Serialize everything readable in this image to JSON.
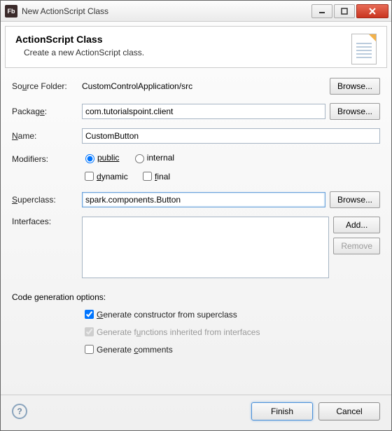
{
  "window": {
    "title": "New ActionScript Class"
  },
  "header": {
    "title": "ActionScript Class",
    "subtitle": "Create a new ActionScript class."
  },
  "form": {
    "sourceFolder": {
      "label": "Source Folder:",
      "value": "CustomControlApplication/src",
      "browse": "Browse..."
    },
    "package": {
      "label": "Package:",
      "value": "com.tutorialspoint.client",
      "browse": "Browse..."
    },
    "name": {
      "label": "Name:",
      "value": "CustomButton"
    },
    "modifiers": {
      "label": "Modifiers:",
      "public": "public",
      "internal": "internal",
      "dynamic": "dynamic",
      "final": "final",
      "selected": "public",
      "dynamicChecked": false,
      "finalChecked": false
    },
    "superclass": {
      "label": "Superclass:",
      "value": "spark.components.Button",
      "browse": "Browse..."
    },
    "interfaces": {
      "label": "Interfaces:",
      "add": "Add...",
      "remove": "Remove"
    }
  },
  "codeGen": {
    "title": "Code generation options:",
    "opt1": {
      "label": "Generate constructor from superclass",
      "checked": true,
      "enabled": true
    },
    "opt2": {
      "label": "Generate functions inherited from interfaces",
      "checked": true,
      "enabled": false
    },
    "opt3": {
      "label": "Generate comments",
      "checked": false,
      "enabled": true
    }
  },
  "footer": {
    "finish": "Finish",
    "cancel": "Cancel"
  }
}
